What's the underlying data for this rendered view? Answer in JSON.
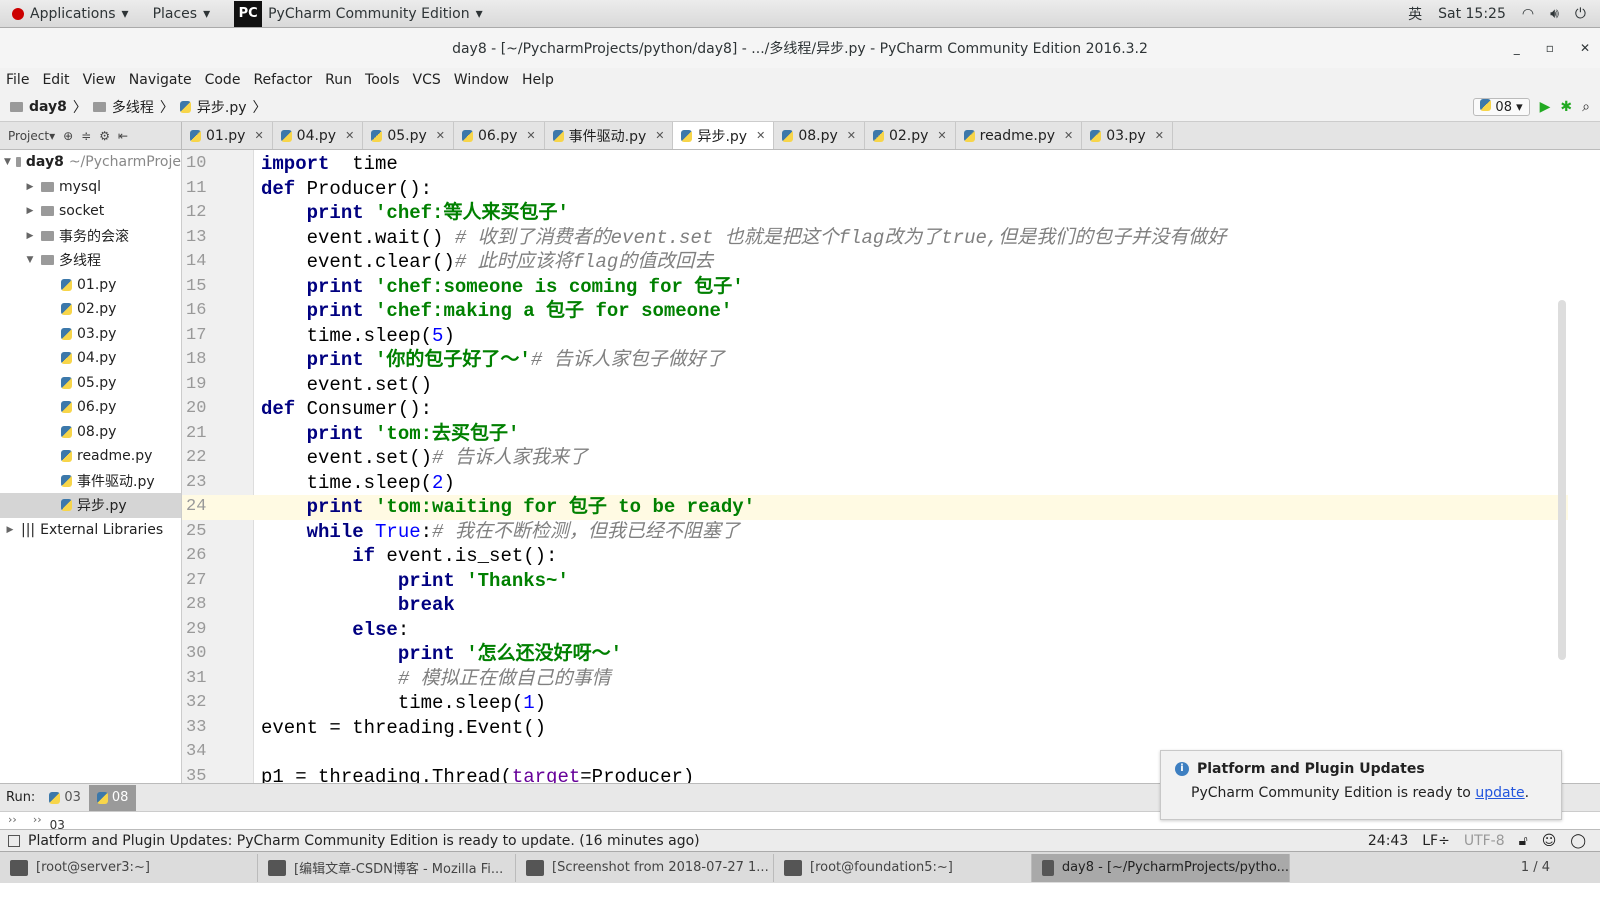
{
  "system": {
    "applications": "Applications",
    "places": "Places",
    "active_app": "PyCharm Community Edition",
    "lang": "英",
    "clock": "Sat 15:25"
  },
  "window": {
    "title": "day8 - [~/PycharmProjects/python/day8] - .../多线程/异步.py - PyCharm Community Edition 2016.3.2"
  },
  "menu": [
    "File",
    "Edit",
    "View",
    "Navigate",
    "Code",
    "Refactor",
    "Run",
    "Tools",
    "VCS",
    "Window",
    "Help"
  ],
  "breadcrumb": [
    "day8",
    "多线程",
    "异步.py"
  ],
  "run_config": "08",
  "project_label": "Project",
  "tabs": [
    {
      "label": "01.py"
    },
    {
      "label": "04.py"
    },
    {
      "label": "05.py"
    },
    {
      "label": "06.py"
    },
    {
      "label": "事件驱动.py"
    },
    {
      "label": "异步.py",
      "active": true
    },
    {
      "label": "08.py"
    },
    {
      "label": "02.py"
    },
    {
      "label": "readme.py"
    },
    {
      "label": "03.py"
    }
  ],
  "tree": [
    {
      "label": "day8",
      "hint": "~/PycharmProje",
      "depth": 0,
      "type": "folder",
      "open": true,
      "bold": true
    },
    {
      "label": "mysql",
      "depth": 1,
      "type": "folder"
    },
    {
      "label": "socket",
      "depth": 1,
      "type": "folder"
    },
    {
      "label": "事务的会滚",
      "depth": 1,
      "type": "folder"
    },
    {
      "label": "多线程",
      "depth": 1,
      "type": "folder",
      "open": true
    },
    {
      "label": "01.py",
      "depth": 2,
      "type": "py"
    },
    {
      "label": "02.py",
      "depth": 2,
      "type": "py"
    },
    {
      "label": "03.py",
      "depth": 2,
      "type": "py"
    },
    {
      "label": "04.py",
      "depth": 2,
      "type": "py"
    },
    {
      "label": "05.py",
      "depth": 2,
      "type": "py"
    },
    {
      "label": "06.py",
      "depth": 2,
      "type": "py"
    },
    {
      "label": "08.py",
      "depth": 2,
      "type": "py"
    },
    {
      "label": "readme.py",
      "depth": 2,
      "type": "py"
    },
    {
      "label": "事件驱动.py",
      "depth": 2,
      "type": "py"
    },
    {
      "label": "异步.py",
      "depth": 2,
      "type": "py",
      "selected": true
    },
    {
      "label": "External Libraries",
      "depth": 0,
      "type": "lib"
    }
  ],
  "editor": {
    "current_line": 24,
    "lines": [
      {
        "n": 10,
        "t": [
          [
            "kw",
            "import"
          ],
          [
            "",
            "  time"
          ]
        ]
      },
      {
        "n": 11,
        "t": [
          [
            "kw",
            "def"
          ],
          [
            "",
            " Producer():"
          ]
        ]
      },
      {
        "n": 12,
        "t": [
          [
            "",
            "    "
          ],
          [
            "kw",
            "print"
          ],
          [
            "str",
            " 'chef:等人来买包子'"
          ]
        ]
      },
      {
        "n": 13,
        "t": [
          [
            "",
            "    event.wait() "
          ],
          [
            "cmt",
            "# 收到了消费者的event.set 也就是把这个flag改为了true,但是我们的包子并没有做好"
          ]
        ]
      },
      {
        "n": 14,
        "t": [
          [
            "",
            "    event.clear()"
          ],
          [
            "cmt",
            "# 此时应该将flag的值改回去"
          ]
        ]
      },
      {
        "n": 15,
        "t": [
          [
            "",
            "    "
          ],
          [
            "kw",
            "print"
          ],
          [
            "str",
            " 'chef:someone is coming for 包子'"
          ]
        ]
      },
      {
        "n": 16,
        "t": [
          [
            "",
            "    "
          ],
          [
            "kw",
            "print"
          ],
          [
            "str",
            " 'chef:making a 包子 for someone'"
          ]
        ]
      },
      {
        "n": 17,
        "t": [
          [
            "",
            "    time.sleep("
          ],
          [
            "num",
            "5"
          ],
          [
            "",
            ")"
          ]
        ]
      },
      {
        "n": 18,
        "t": [
          [
            "",
            "    "
          ],
          [
            "kw",
            "print"
          ],
          [
            "str",
            " '你的包子好了～'"
          ],
          [
            "cmt",
            "# 告诉人家包子做好了"
          ]
        ]
      },
      {
        "n": 19,
        "t": [
          [
            "",
            "    event.set()"
          ]
        ]
      },
      {
        "n": 20,
        "t": [
          [
            "kw",
            "def"
          ],
          [
            "",
            " Consumer():"
          ]
        ]
      },
      {
        "n": 21,
        "t": [
          [
            "",
            "    "
          ],
          [
            "kw",
            "print"
          ],
          [
            "str",
            " 'tom:去买包子'"
          ]
        ]
      },
      {
        "n": 22,
        "t": [
          [
            "",
            "    event.set()"
          ],
          [
            "cmt",
            "# 告诉人家我来了"
          ]
        ]
      },
      {
        "n": 23,
        "t": [
          [
            "",
            "    time.sleep("
          ],
          [
            "num",
            "2"
          ],
          [
            "",
            ")"
          ]
        ]
      },
      {
        "n": 24,
        "t": [
          [
            "",
            "    "
          ],
          [
            "kw",
            "print"
          ],
          [
            "str",
            " 'tom:waiting for 包子 to be ready'"
          ]
        ]
      },
      {
        "n": 25,
        "t": [
          [
            "",
            "    "
          ],
          [
            "kw",
            "while"
          ],
          [
            "num",
            " True"
          ],
          [
            "",
            ":"
          ],
          [
            "cmt",
            "# 我在不断检测，但我已经不阻塞了"
          ]
        ]
      },
      {
        "n": 26,
        "t": [
          [
            "",
            "        "
          ],
          [
            "kw",
            "if"
          ],
          [
            "",
            " event.is_set():"
          ]
        ]
      },
      {
        "n": 27,
        "t": [
          [
            "",
            "            "
          ],
          [
            "kw",
            "print"
          ],
          [
            "str",
            " 'Thanks~'"
          ]
        ]
      },
      {
        "n": 28,
        "t": [
          [
            "",
            "            "
          ],
          [
            "kw",
            "break"
          ]
        ]
      },
      {
        "n": 29,
        "t": [
          [
            "",
            "        "
          ],
          [
            "kw",
            "else"
          ],
          [
            "",
            ":"
          ]
        ]
      },
      {
        "n": 30,
        "t": [
          [
            "",
            "            "
          ],
          [
            "kw",
            "print"
          ],
          [
            "str",
            " '怎么还没好呀～'"
          ]
        ]
      },
      {
        "n": 31,
        "t": [
          [
            "",
            "            "
          ],
          [
            "cmt",
            "# 模拟正在做自己的事情"
          ]
        ]
      },
      {
        "n": 32,
        "t": [
          [
            "",
            "            time.sleep("
          ],
          [
            "num",
            "1"
          ],
          [
            "",
            ")"
          ]
        ]
      },
      {
        "n": 33,
        "t": [
          [
            "",
            "event = threading.Event()"
          ]
        ]
      },
      {
        "n": 34,
        "t": []
      },
      {
        "n": 35,
        "t": [
          [
            "",
            "p1 = threading.Thread("
          ],
          [
            "param",
            "target"
          ],
          [
            "",
            "=Producer)"
          ]
        ]
      }
    ]
  },
  "run": {
    "label": "Run:",
    "tabs": [
      "03",
      "08"
    ],
    "console_peek": "03"
  },
  "notification": {
    "title": "Platform and Plugin Updates",
    "body": "PyCharm Community Edition is ready to ",
    "link": "update",
    "end": "."
  },
  "status": {
    "message": "Platform and Plugin Updates: PyCharm Community Edition is ready to update. (16 minutes ago)",
    "position": "24:43",
    "line_sep": "LF÷",
    "encoding": "UTF-8"
  },
  "taskbar": {
    "items": [
      "[root@server3:~]",
      "[编辑文章-CSDN博客 - Mozilla Fi...",
      "[Screenshot from 2018-07-27 1...",
      "[root@foundation5:~]",
      "day8 - [~/PycharmProjects/pytho..."
    ],
    "active": 4,
    "workspace": "1 / 4"
  },
  "colors": {
    "keyword": "#000080",
    "string": "#008000",
    "comment": "#808080",
    "number": "#0000ff",
    "current_line": "#fffae3"
  }
}
